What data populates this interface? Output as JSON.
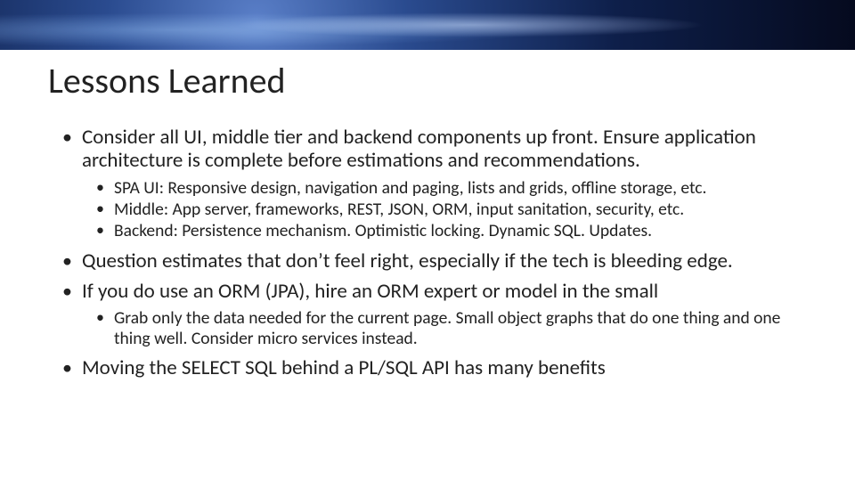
{
  "title": "Lessons Learned",
  "bullets": {
    "b1": "Consider all UI, middle tier and backend components up front. Ensure application architecture is complete before estimations and recommendations.",
    "b1_sub": {
      "s1": "SPA UI: Responsive design, navigation and paging, lists and grids, offline storage, etc.",
      "s2": "Middle: App server, frameworks, REST, JSON, ORM, input sanitation, security, etc.",
      "s3": "Backend: Persistence mechanism. Optimistic locking. Dynamic SQL. Updates."
    },
    "b2": "Question estimates that don’t feel right, especially if the tech is bleeding edge.",
    "b3": "If you do use an ORM (JPA), hire an ORM expert or model in the small",
    "b3_sub": {
      "s1": "Grab only the data needed for the current page. Small object graphs that do one thing and one thing well. Consider micro services instead."
    },
    "b4": "Moving the SELECT SQL behind a PL/SQL API has many benefits"
  }
}
